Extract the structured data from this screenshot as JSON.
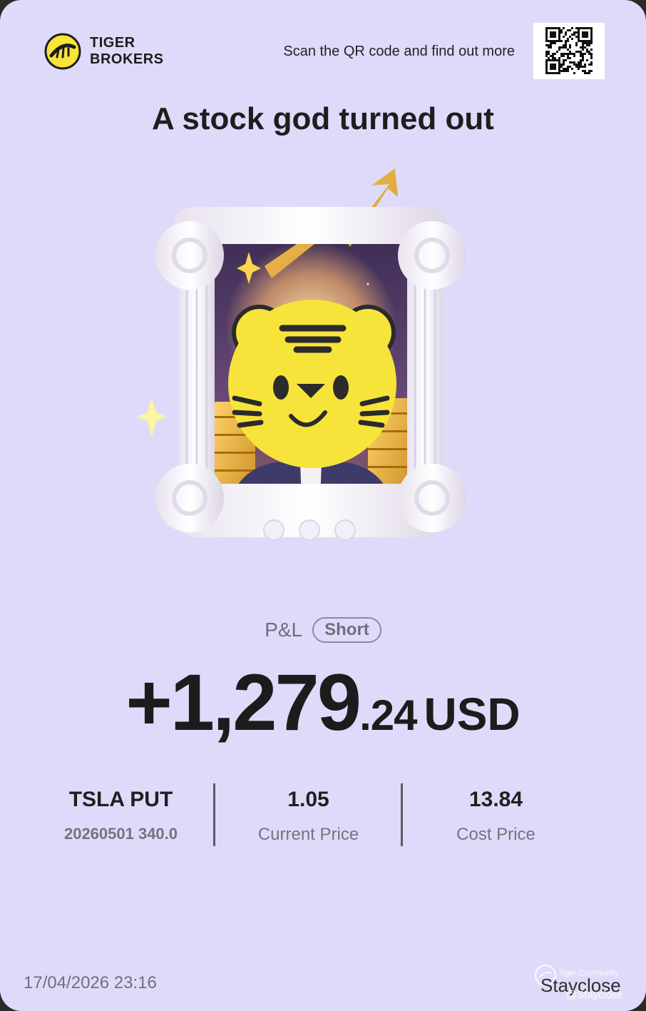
{
  "brand": {
    "line1": "TIGER",
    "line2": "BROKERS"
  },
  "header": {
    "scan_text": "Scan the QR code and find out more"
  },
  "headline": "A stock god turned out",
  "pnl": {
    "label": "P&L",
    "badge": "Short",
    "amount_integer": "+1,279",
    "amount_decimal": ".24",
    "currency": "USD"
  },
  "stats": {
    "instrument": {
      "value": "TSLA PUT",
      "label": "20260501 340.0"
    },
    "current": {
      "value": "1.05",
      "label": "Current Price"
    },
    "cost": {
      "value": "13.84",
      "label": "Cost Price"
    }
  },
  "footer": {
    "timestamp": "17/04/2026 23:16"
  },
  "watermark": {
    "community": "Tiger Community",
    "name": "Stayclose",
    "handle": "@Stayclose"
  },
  "colors": {
    "background": "#dedbfa",
    "text": "#1c1c1c",
    "muted": "#6f6e7c",
    "tiger": "#f7e43a"
  }
}
